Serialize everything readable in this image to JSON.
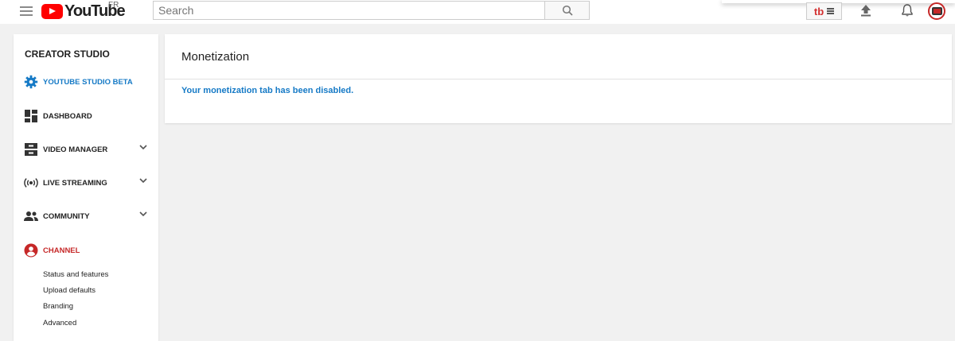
{
  "header": {
    "logo_text": "YouTube",
    "region": "FR",
    "search_placeholder": "Search",
    "extension_mark": "tb"
  },
  "sidebar": {
    "title": "CREATOR STUDIO",
    "items": [
      {
        "label": "YOUTUBE STUDIO BETA",
        "icon": "gear-icon"
      },
      {
        "label": "DASHBOARD",
        "icon": "dashboard-icon"
      },
      {
        "label": "VIDEO MANAGER",
        "icon": "video-manager-icon"
      },
      {
        "label": "LIVE STREAMING",
        "icon": "live-streaming-icon"
      },
      {
        "label": "COMMUNITY",
        "icon": "community-icon"
      },
      {
        "label": "CHANNEL",
        "icon": "channel-icon"
      }
    ],
    "channel_subitems": [
      "Status and features",
      "Upload defaults",
      "Branding",
      "Advanced"
    ]
  },
  "main": {
    "title": "Monetization",
    "message": "Your monetization tab has been disabled."
  },
  "colors": {
    "accent_blue": "#167ac6",
    "channel_red": "#c62828",
    "brand_red": "#ff0000"
  }
}
